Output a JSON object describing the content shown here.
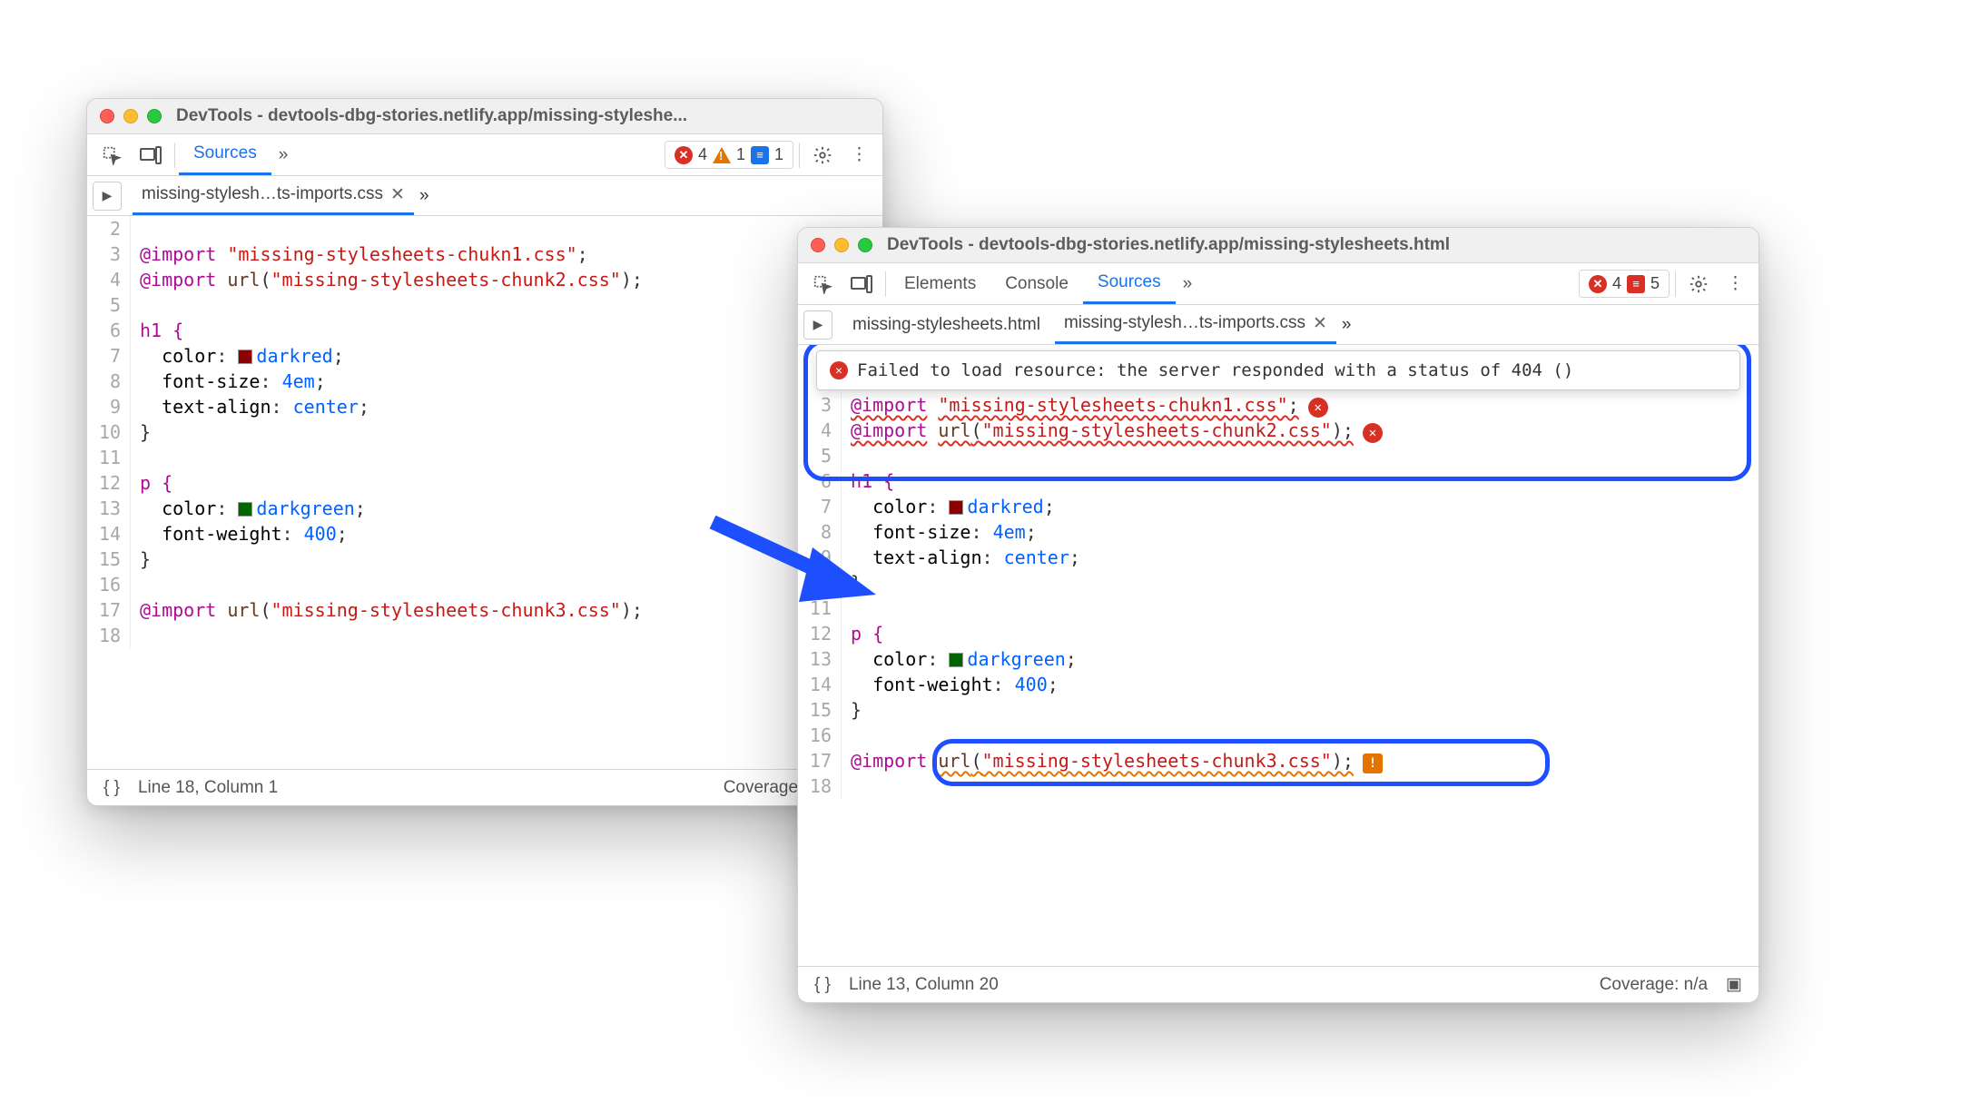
{
  "win1": {
    "title": "DevTools - devtools-dbg-stories.netlify.app/missing-styleshe...",
    "toolbar": {
      "tab_sources": "Sources",
      "errors": "4",
      "warnings": "1",
      "info": "1"
    },
    "tabs": {
      "file1": "missing-stylesh…ts-imports.css"
    },
    "code": {
      "l3_kw": "@import",
      "l3_str": "\"missing-stylesheets-chukn1.css\"",
      "l4_kw": "@import",
      "l4_fn": "url",
      "l4_str": "\"missing-stylesheets-chunk2.css\"",
      "l6_sel": "h1 {",
      "l7_prop": "color",
      "l7_val": "darkred",
      "l7_sw": "#8b0000",
      "l8_prop": "font-size",
      "l8_val": "4em",
      "l9_prop": "text-align",
      "l9_val": "center",
      "l10": "}",
      "l12_sel": "p {",
      "l13_prop": "color",
      "l13_val": "darkgreen",
      "l13_sw": "#006400",
      "l14_prop": "font-weight",
      "l14_val": "400",
      "l15": "}",
      "l17_kw": "@import",
      "l17_fn": "url",
      "l17_str": "\"missing-stylesheets-chunk3.css\""
    },
    "status": {
      "pos": "Line 18, Column 1",
      "coverage": "Coverage: n/a"
    }
  },
  "win2": {
    "title": "DevTools - devtools-dbg-stories.netlify.app/missing-stylesheets.html",
    "toolbar": {
      "tab_elements": "Elements",
      "tab_console": "Console",
      "tab_sources": "Sources",
      "errors": "4",
      "issues": "5"
    },
    "tabs": {
      "file0": "missing-stylesheets.html",
      "file1": "missing-stylesh…ts-imports.css"
    },
    "tooltip": "Failed to load resource: the server responded with a status of 404 ()",
    "code": {
      "l3_kw": "@import",
      "l3_str": "\"missing-stylesheets-chukn1.css\"",
      "l4_kw": "@import",
      "l4_fn": "url",
      "l4_str": "\"missing-stylesheets-chunk2.css\"",
      "l6_sel": "h1 {",
      "l7_prop": "color",
      "l7_val": "darkred",
      "l7_sw": "#8b0000",
      "l8_prop": "font-size",
      "l8_val": "4em",
      "l9_prop": "text-align",
      "l9_val": "center",
      "l10": "}",
      "l12_sel": "p {",
      "l13_prop": "color",
      "l13_val": "darkgreen",
      "l13_sw": "#006400",
      "l14_prop": "font-weight",
      "l14_val": "400",
      "l15": "}",
      "l17_kw": "@import",
      "l17_fn": "url",
      "l17_str": "\"missing-stylesheets-chunk3.css\""
    },
    "status": {
      "pos": "Line 13, Column 20",
      "coverage": "Coverage: n/a"
    }
  }
}
